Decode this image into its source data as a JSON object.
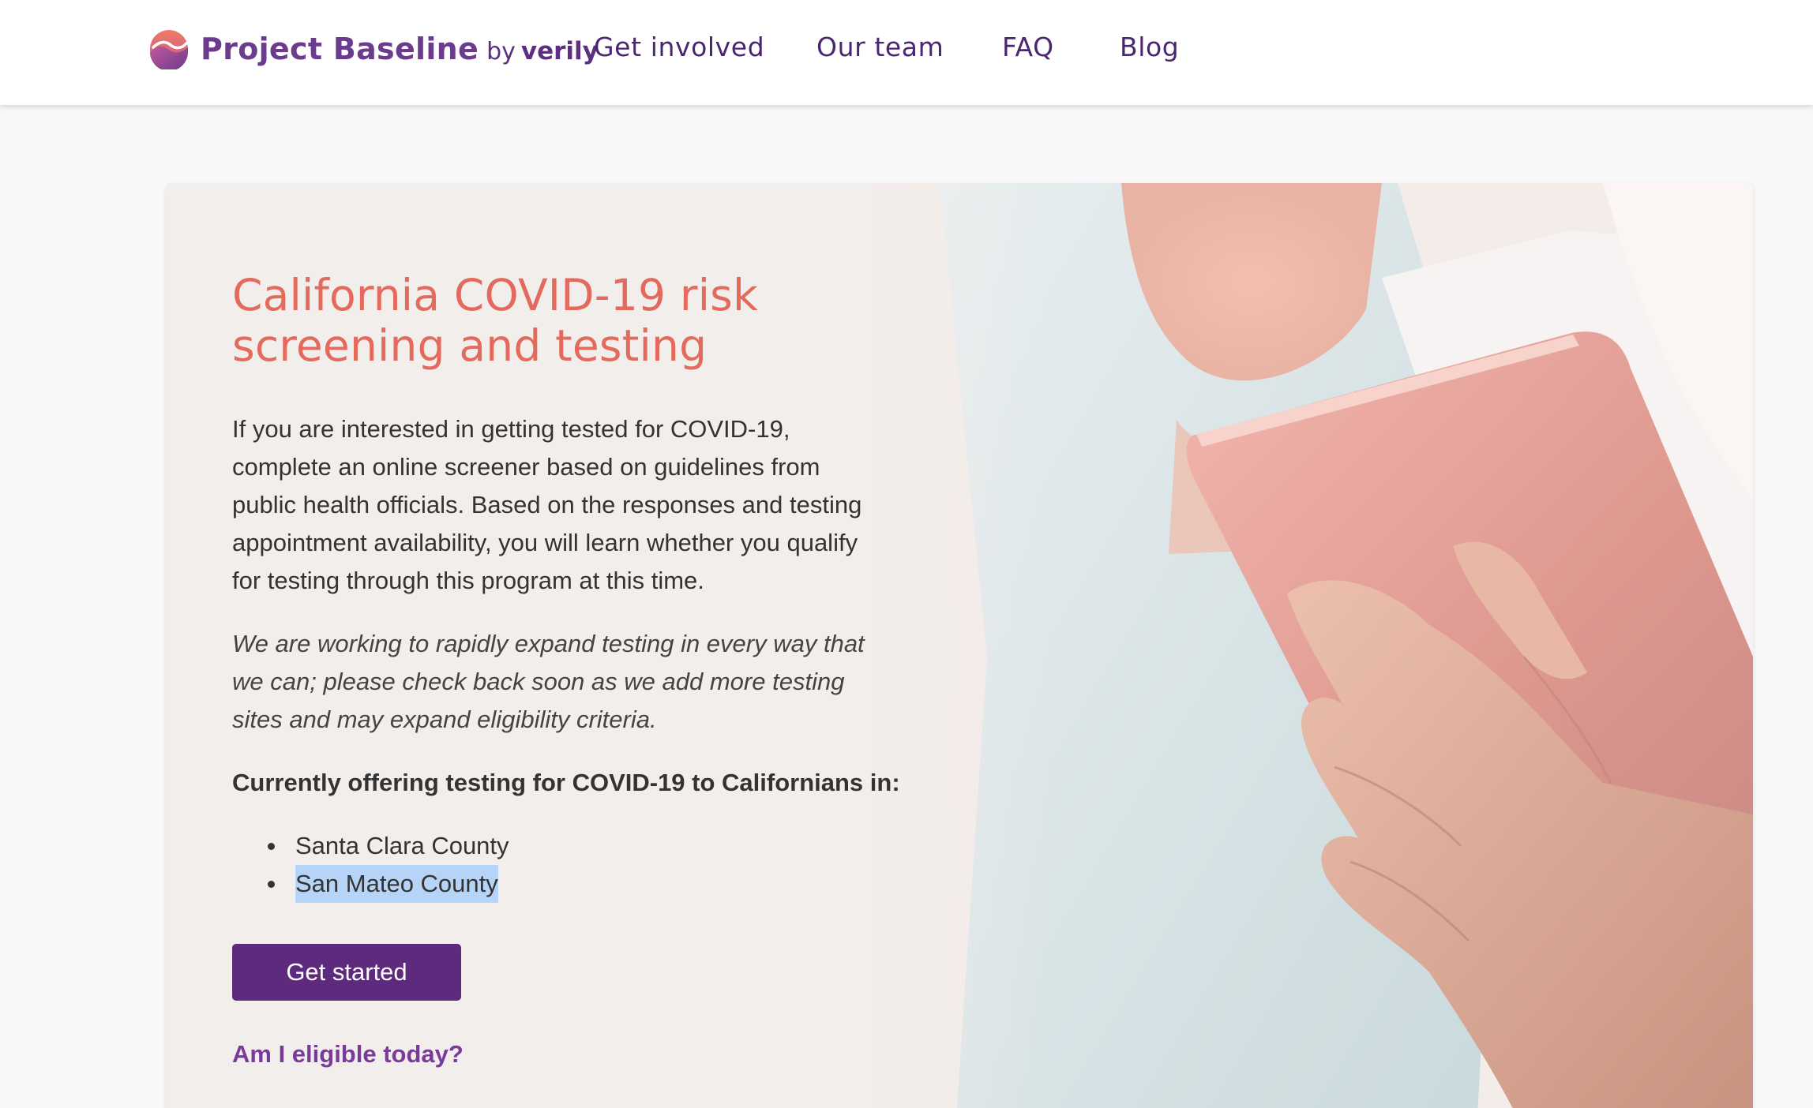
{
  "header": {
    "brand": {
      "name": "Project Baseline",
      "by": "by",
      "verily": "verily",
      "logo_icon": "baseline-logo-icon"
    },
    "nav": [
      {
        "label": "Get involved"
      },
      {
        "label": "Our team"
      },
      {
        "label": "FAQ"
      },
      {
        "label": "Blog"
      }
    ]
  },
  "hero": {
    "title_lines": [
      "California COVID-19 risk",
      "screening and testing"
    ],
    "body_lines": [
      "If you are interested in getting tested for COVID-19,",
      "complete an online screener based on guidelines from",
      "public health officials. Based on the responses and testing",
      "appointment availability, you will learn whether you qualify",
      "for testing through this program at this time."
    ],
    "italic_lines": [
      "We are working to rapidly expand testing in every way that",
      "we can; please check back soon as we add more testing",
      "sites and may expand eligibility criteria."
    ],
    "offering_heading": "Currently offering testing for COVID-19 to Californians in:",
    "counties": [
      {
        "name": "Santa Clara County",
        "selected": false
      },
      {
        "name": "San Mateo County",
        "selected": true
      }
    ],
    "cta_label": "Get started",
    "eligibility_link": "Am I eligible today?"
  },
  "colors": {
    "brand_purple": "#6b3b8e",
    "nav_purple": "#4a2670",
    "title_coral": "#e36a5c",
    "button_purple": "#5e2a7e",
    "link_purple": "#7a3a9a",
    "selection_blue": "#b6d4f7",
    "card_bg": "#f1eeec",
    "page_bg": "#f8f8f8"
  }
}
